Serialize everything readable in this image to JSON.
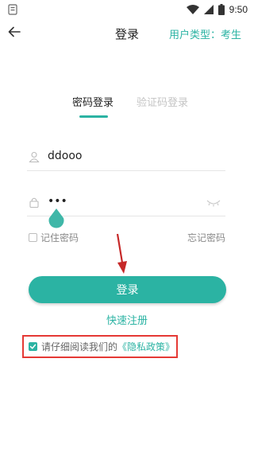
{
  "status_bar": {
    "time": "9:50",
    "icons": [
      "notification-icon",
      "wifi-icon",
      "signal-icon",
      "battery-icon"
    ]
  },
  "header": {
    "title": "登录",
    "user_type": "用户类型：考生",
    "back_icon": "arrow-left-icon"
  },
  "tabs": [
    {
      "label": "密码登录",
      "active": true
    },
    {
      "label": "验证码登录",
      "active": false
    }
  ],
  "username": {
    "value": "ddooo",
    "icon": "user-icon"
  },
  "password": {
    "value": "•••",
    "icon": "lock-icon",
    "toggle_icon": "eye-closed-icon"
  },
  "remember": {
    "label": "记住密码",
    "checked": false
  },
  "forgot_label": "忘记密码",
  "login_button": "登录",
  "quick_register": "快速注册",
  "agreement": {
    "checked": true,
    "text": "请仔细阅读我们的",
    "link": "《隐私政策》"
  },
  "colors": {
    "accent": "#2bb3a3",
    "annotation": "#e53935"
  }
}
